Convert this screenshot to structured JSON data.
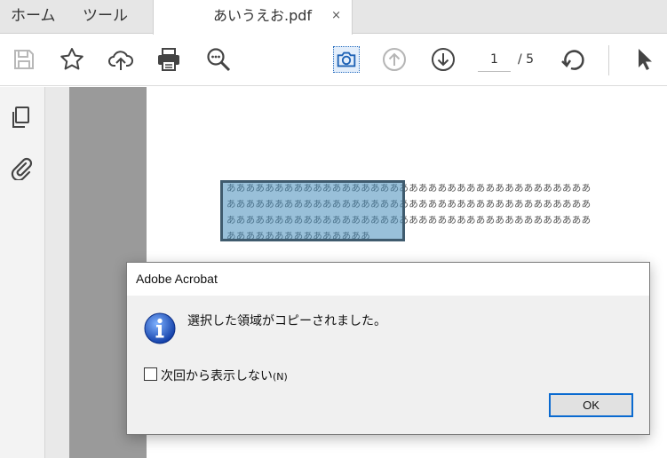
{
  "tabs": {
    "home_label": "ホーム",
    "tools_label": "ツール",
    "document_label": "あいうえお.pdf",
    "close_glyph": "×"
  },
  "toolbar": {
    "icons": [
      "save-icon",
      "star-icon",
      "cloud-upload-icon",
      "print-icon",
      "zoom-search-icon",
      "snapshot-camera-icon",
      "page-up-icon",
      "page-down-icon",
      "rotate-icon",
      "select-pointer-icon"
    ],
    "current_page": "1",
    "total_pages": "/ 5",
    "accent_color": "#2a6fbf"
  },
  "sidebar": {
    "icons": [
      "pages-icon",
      "attachment-icon"
    ]
  },
  "document": {
    "lines": [
      "ああああああああああああああああああああああああああああああああああああああ",
      "ああああああああああああああああああああああああああああああああああああああ",
      "ああああああああああああああああああああああああああああああああああああああ",
      "あああああああああああああああ"
    ],
    "selection_color": "#468cb9"
  },
  "dialog": {
    "title": "Adobe Acrobat",
    "message": "選択した領域がコピーされました。",
    "checkbox_label": "次回から表示しない",
    "checkbox_shortcut": "(N)",
    "checkbox_checked": false,
    "ok_label": "OK",
    "icon": "info-icon"
  }
}
